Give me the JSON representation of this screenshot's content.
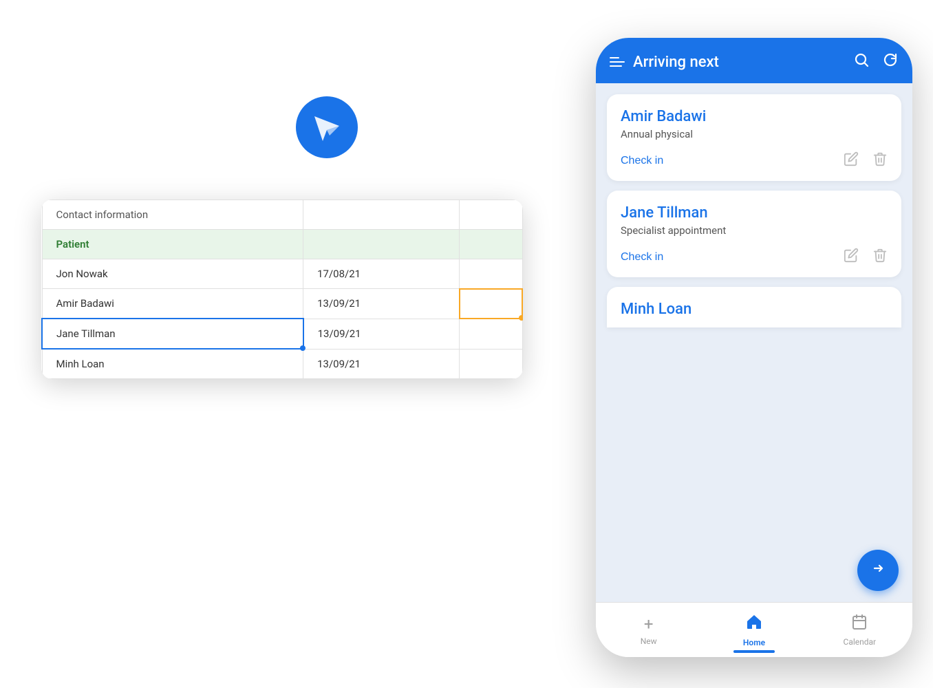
{
  "app": {
    "logo_icon": "paper-plane"
  },
  "spreadsheet": {
    "header": {
      "col1": "Contact information",
      "col2": "",
      "col3": ""
    },
    "section_label": "Patient",
    "rows": [
      {
        "name": "Jon Nowak",
        "date": "17/08/21",
        "col3": ""
      },
      {
        "name": "Amir Badawi",
        "date": "13/09/21",
        "col3": ""
      },
      {
        "name": "Jane Tillman",
        "date": "13/09/21",
        "col3": "",
        "selected": true
      },
      {
        "name": "Minh Loan",
        "date": "13/09/21",
        "col3": ""
      }
    ]
  },
  "phone": {
    "header": {
      "menu_icon": "☰",
      "title": "Arriving next",
      "search_icon": "search",
      "refresh_icon": "refresh"
    },
    "patients": [
      {
        "name": "Amir Badawi",
        "appointment": "Annual physical",
        "check_in_label": "Check in"
      },
      {
        "name": "Jane Tillman",
        "appointment": "Specialist appointment",
        "check_in_label": "Check in"
      }
    ],
    "partial_patient": {
      "name": "Minh Loan"
    },
    "fab_icon": "→",
    "bottom_nav": [
      {
        "icon": "+",
        "label": "New",
        "active": false
      },
      {
        "icon": "⌂",
        "label": "Home",
        "active": true
      },
      {
        "icon": "📅",
        "label": "Calendar",
        "active": false
      }
    ]
  }
}
